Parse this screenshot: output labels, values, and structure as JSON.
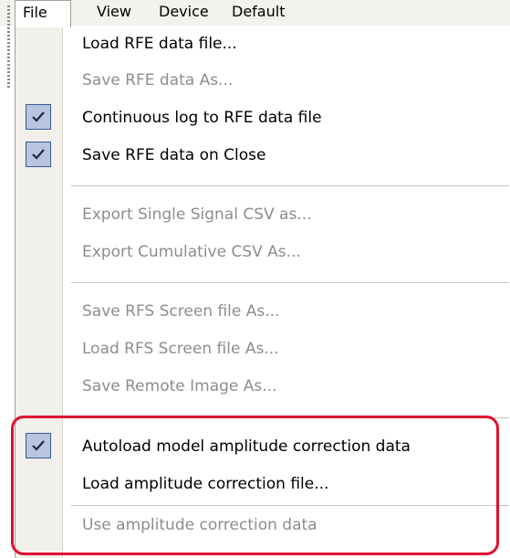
{
  "menubar": {
    "items": [
      {
        "label": "File"
      },
      {
        "label": "View"
      },
      {
        "label": "Device"
      },
      {
        "label": "Default"
      }
    ]
  },
  "file_menu": {
    "items": [
      {
        "label": "Load RFE data file...",
        "enabled": true,
        "checked": false
      },
      {
        "label": "Save RFE data As...",
        "enabled": false,
        "checked": false
      },
      {
        "label": "Continuous log to RFE data file",
        "enabled": true,
        "checked": true
      },
      {
        "label": "Save RFE data on Close",
        "enabled": true,
        "checked": true
      },
      {
        "label": "Export Single Signal CSV as...",
        "enabled": false,
        "checked": false
      },
      {
        "label": "Export Cumulative CSV As...",
        "enabled": false,
        "checked": false
      },
      {
        "label": "Save RFS Screen file As...",
        "enabled": false,
        "checked": false
      },
      {
        "label": "Load RFS Screen file As...",
        "enabled": false,
        "checked": false
      },
      {
        "label": "Save Remote Image As...",
        "enabled": false,
        "checked": false
      },
      {
        "label": "Autoload model amplitude correction data",
        "enabled": true,
        "checked": true
      },
      {
        "label": "Load amplitude correction file...",
        "enabled": true,
        "checked": false
      },
      {
        "label": "Use amplitude correction data",
        "enabled": false,
        "checked": false
      }
    ]
  },
  "colors": {
    "highlight": "#e0102e",
    "check_bg": "#b9c4de",
    "check_border": "#3c5a96",
    "disabled_text": "#8d8d8d"
  },
  "icons": {
    "check": "checkmark-icon",
    "grip": "toolbar-grip-icon"
  }
}
